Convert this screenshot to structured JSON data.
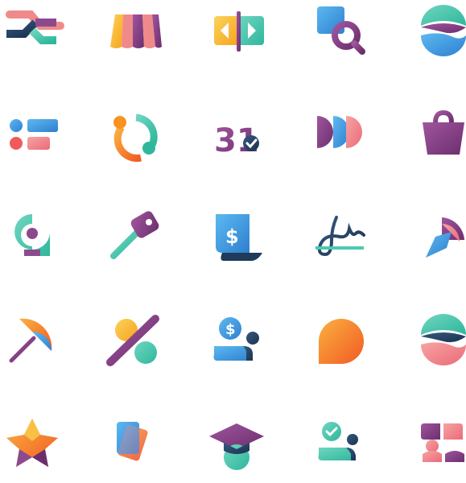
{
  "icons": [
    {
      "name": "shuffle-arrows-icon"
    },
    {
      "name": "storefront-awning-icon"
    },
    {
      "name": "slider-navigation-icon"
    },
    {
      "name": "shape-search-icon"
    },
    {
      "name": "sphere-waves-icon"
    },
    {
      "name": "toggle-list-icon"
    },
    {
      "name": "circular-sync-icon"
    },
    {
      "name": "calendar-31-check-icon",
      "text": "31"
    },
    {
      "name": "overlapping-half-circles-icon"
    },
    {
      "name": "shopping-bag-icon"
    },
    {
      "name": "location-pin-user-icon"
    },
    {
      "name": "key-icon"
    },
    {
      "name": "invoice-dollar-icon",
      "text": "$"
    },
    {
      "name": "signature-icon"
    },
    {
      "name": "abstract-petal-icon"
    },
    {
      "name": "umbrella-icon"
    },
    {
      "name": "percent-icon"
    },
    {
      "name": "salary-payment-icon",
      "text": "$"
    },
    {
      "name": "speech-bubble-icon"
    },
    {
      "name": "sphere-waves-pink-icon"
    },
    {
      "name": "star-icon"
    },
    {
      "name": "stacked-cards-icon"
    },
    {
      "name": "graduation-cap-icon"
    },
    {
      "name": "user-approved-icon"
    },
    {
      "name": "shapes-team-icon"
    }
  ],
  "colors": {
    "purple": "#8c4a8e",
    "teal": "#4cc9b0",
    "blue": "#4aa3e0",
    "orange": "#f7931e",
    "yellow": "#f8c146",
    "pink": "#f08a8a",
    "red": "#f05a5a",
    "navy": "#1f3a5a"
  }
}
